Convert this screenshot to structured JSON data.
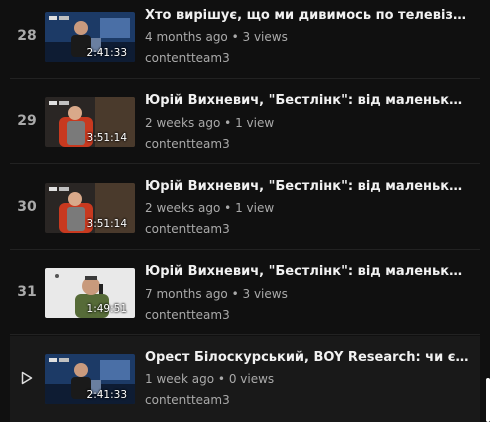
{
  "playlist": {
    "items": [
      {
        "index": "28",
        "title": "Хто вирішує, що ми дивимось по телевізору? Оле...",
        "age": "4 months ago",
        "views": "3 views",
        "channel": "contentteam3",
        "duration": "2:41:33",
        "thumbnail": "studio-interview-thumbnail",
        "current": false
      },
      {
        "index": "29",
        "title": "Юрій Вихневич, \"Бестлінк\": від маленького офіс...",
        "age": "2 weeks ago",
        "views": "1 view",
        "channel": "contentteam3",
        "duration": "3:51:14",
        "thumbnail": "red-chair-thumbnail",
        "current": false
      },
      {
        "index": "30",
        "title": "Юрій Вихневич, \"Бестлінк\": від маленького офіс...",
        "age": "2 weeks ago",
        "views": "1 view",
        "channel": "contentteam3",
        "duration": "3:51:14",
        "thumbnail": "red-chair-thumbnail",
        "current": false
      },
      {
        "index": "31",
        "title": "Юрій Вихневич, \"Бестлінк\": від маленького офіс...",
        "age": "7 months ago",
        "views": "3 views",
        "channel": "contentteam3",
        "duration": "1:49:51",
        "thumbnail": "phone-call-thumbnail",
        "current": false
      },
      {
        "index": "",
        "title": "Орест Білоскурський, BOY Research: чи є майбут...",
        "age": "1 week ago",
        "views": "0 views",
        "channel": "contentteam3",
        "duration": "2:41:33",
        "thumbnail": "studio-interview-thumbnail",
        "current": true,
        "indicator_icon": "play-icon"
      }
    ]
  }
}
